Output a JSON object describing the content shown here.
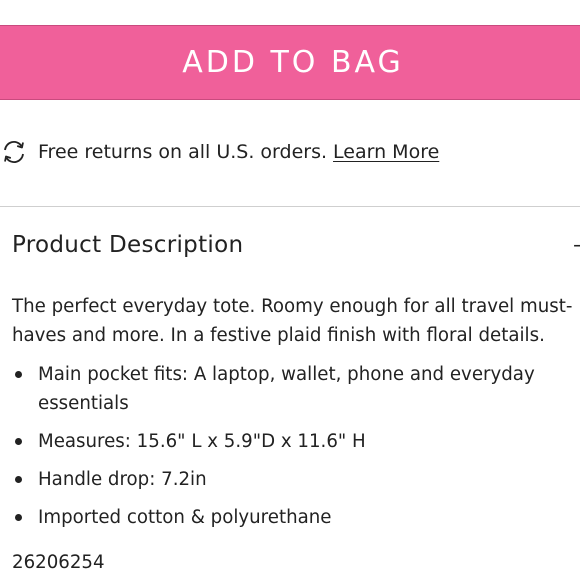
{
  "cta": {
    "label": "ADD TO BAG",
    "color": "#f0609a"
  },
  "returns": {
    "icon": "refresh-arrows-icon",
    "text": "Free returns on all U.S. orders.",
    "link": "Learn More"
  },
  "section": {
    "title": "Product Description",
    "toggle": "–"
  },
  "description": "The perfect everyday tote. Roomy enough for all travel must-haves and more. In a festive plaid finish with floral details.",
  "bullets": [
    "Main pocket fits: A laptop, wallet, phone and everyday essentials",
    "Measures: 15.6\" L x 5.9\"D x 11.6\" H",
    "Handle drop: 7.2in",
    "Imported cotton & polyurethane"
  ],
  "sku": "26206254"
}
